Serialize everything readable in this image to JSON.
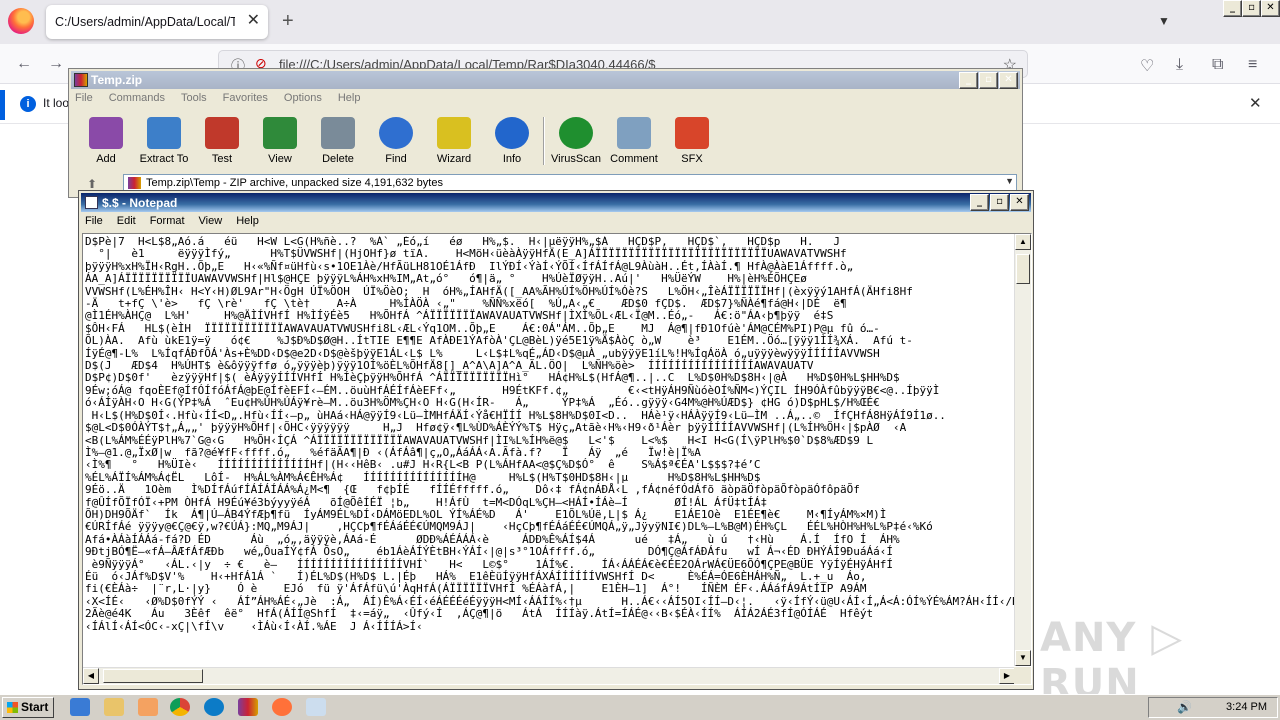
{
  "browser": {
    "tab_title": "C:/Users/admin/AppData/Local/Temp/Ra",
    "tab_close": "✕",
    "new_tab": "+",
    "list_tabs": "▼",
    "url": "file:///C:/Users/admin/AppData/Local/Temp/Rar$DIa3040.44466/$",
    "notification_text": "It loo",
    "notification_close": "✕",
    "caption": {
      "minimize": "_",
      "maximize": "▫",
      "close": "✕"
    },
    "back": "←",
    "forward": "→",
    "reload": "⟳",
    "home": "⌂"
  },
  "winrar": {
    "title": "Temp.zip",
    "menu": [
      "File",
      "Commands",
      "Tools",
      "Favorites",
      "Options",
      "Help"
    ],
    "toolbar": [
      {
        "label": "Add",
        "color": "#8a4aa8"
      },
      {
        "label": "Extract To",
        "color": "#3d7fc9"
      },
      {
        "label": "Test",
        "color": "#c0392b"
      },
      {
        "label": "View",
        "color": "#2f8a3a"
      },
      {
        "label": "Delete",
        "color": "#7a8b99"
      },
      {
        "label": "Find",
        "color": "#2f6fd0"
      },
      {
        "label": "Wizard",
        "color": "#d9c020"
      },
      {
        "label": "Info",
        "color": "#2266cc"
      },
      {
        "label": "VirusScan",
        "color": "#1f8f2f"
      },
      {
        "label": "Comment",
        "color": "#7fa0c0"
      },
      {
        "label": "SFX",
        "color": "#d8452a"
      }
    ],
    "path": "Temp.zip\\Temp - ZIP archive, unpacked size 4,191,632 bytes"
  },
  "notepad": {
    "title": "$.$ - Notepad",
    "menu": [
      "File",
      "Edit",
      "Format",
      "View",
      "Help"
    ],
    "content": "D$Pè|7  H<L$8„Aó.á   éü   H<W L<G(H%ñè..?  %Á` „Éó„í   éø   H%„$.  H‹|µëÿÿH%„$Á   HÇD$P,   HÇD$`,   HÇD$p   H.   J\n  °|   è1     ëÿÿÿÌfý„      H%T$ÜVWSHf|(HjOHf}ø tïA.    H<MöH‹üèàÀÿÿHfÄ(E_A]ÁÏÏÏÏÏÏÏÏÏÏÏÏÏÏÏÏÏÏÏÏÏÏÏÏÏÏUAWAVATVWSHf\nþÿÿÿH%xH%ÏH‹RgH..Õþ„E   H‹«%Ñf¤üHfù‹s•1OE1Àè/HfÃüLH81OÉ1ÁfÐ  IlÝÐÍ‹ÝàÍ‹ÝÕÍ‹ÍfÁÍfÁ@L9ÀùàH..Ét,ÍÀàÍ.¶ HfÀ@ÀàE1Áffff.ò„\nÁA_A]ÁÏÏÏÏÏÏÏÏÏÏUAWAVVWSHf|Hl$@HÇE þÿÿÿL%ÁH%xH%IM„At„ó°   ó¶|ä„ °    H%ÚèÏØÿÿH..Aú|'   H%ÜëÝW    H%|èH%ÉÕHÇEø\nVVWSHf(L%ÉH%ÎH‹ H<Y‹H)ØL9Ar\"H‹ÖgH ÚÏ%ÖOH  ÚÏ%ÖèO;  H  óH%„ÍAHfÄ([_AA%ÃH%ÚÍ%ÖH%ÚÍ%Óè?S   L%ÖH‹„ÎèÁÏÏÏÏÏÏHf|(èxÿÿý1AHfÁ(ÄHfi8Hf\n-Ä   t+fÇ \\'è>   fÇ \\rè'   fÇ \\tè†    A÷À     H%ÍÀÖÀ ‹„\"    %ÑÑ%xëó[  %Ú„A‹„€    ÆD$0 fÇD$.  ÆD$7}%ÑÀé¶fá@H‹|DÉ  ë¶\n@Ì1ÉH%ÀHÇ@  L%H'     H%@ÄÌÍVHfÍ H%ÌÍÿÉè5   H%ÕHfÁ ^ÁÏÏÏÏÏÏÏAWAVAUATVWSHf|ÌXÌ%ÕL‹ÆL‹Ï@M..Éó„-   Á€:ö\"ÁA‹þ¶þÿÿ  é‡S\n$ÔH‹FÁ   HL$(èÌH  ÏÏÏÏÏÏÏÏÏÏÏÏAWAVAUATVWUSHfi8L‹ÆL‹Ýq1OM..Õþ„E    Á€:0Á\"ÁM..Õþ„E    MJ  Á@¶|fÐ1Ofúè'ÁM@CÉM%PI)P@µ fû ó…-\nÕL)ÀA.  Afù ùkE1ÿ=ÿ   ó¢€    %J$Ð%D$Ø@H..ÍtTIE E¶¶E AfÀÐE1ÝAfòÀ'ÇL@BèL)ÿé5E1ÿ%Ä$ÀòÇ ò„W    è³    E1ÉM..Öó…[ÿÿÿ1ÌÍ¾XÁ.  Afú t-\nÍÿÉ@¶-L%  L%ÍqfÁÐfÕÁ'Às+È%DD‹D$@e2D‹D$@èšþÿÿE1ÁL‹L$ L%     L‹L$‡L%qÉ„ÁD‹D$@µÀ „ubÿÿÿE1íL%!H%ÍqÁöÀ ó„uÿÿÿèwÿÿÿÍÍÍÍÍAVVWSH\nD$(J   ÆD$4  H%ÚHT$ è&ôÿÿÿffø ó„ÿÿÿèþ)ÿÿÿ1OÍ%öÈL%ÕHfÄ8[]_A^A\\A]A^A_ÃL.ÖO|  L%ÑH%öè>  ÍÍÍÍÍÍÍÍÍÍÍÍÍÍÍÍAWAVAUATV\nD$P¢)D$0f'   èzÿÿÿHf|$( èÁÿÿÿÍÍÍVHfÍ H%ÍèÇþÿÿH%ÕHfÁ ^ÁÏÏÏÏÏÏÏÏÏÏHì°   HÁ¢H%L$(HfÁ@¶..|..C  L%D$0H%D$8H‹|@À   H%D$0H%L$HH%D$\n9Éw;óÁ@ fqoÈEf@ÍfÓÍfóÁfÁ@þE@ÍfèEFÍ‹—ÉM..öuùHfÁÉÍfÁèEFf‹„       H9ÉtKFf.¢„         €‹<tHÿÁH9ÑùóèOÍ%ÑM<)ÝÇIL ÍH9ÓÀfûbÿÿÿB€<@..ÍþÿÿÌ\nó‹ÁÍÿÀH‹O H‹G(ÝP‡%Á  ˆEu¢H%ÚH%ÚÁÿ¥rè—M..öu3H%ÖM%ÇH‹O H‹G(H‹ÍR-   Á„     ÝP‡%Á  „Éó..gÿÿÿ‹G4M%@H%ÚÆD$} ¢HG ó)D$pHL$/H%ŒÉ€\n H‹L$(H%D$0Í‹.Hfù‹ÍÍ<D„.Hfù‹ÍÍ‹—p„ ùHAá‹HÁ@ÿÿÍ9‹Lü—ÌMHfÁÄÍ‹Ýå€HÏÍÍ H%L$8H%D$0I<D..  HÁè¹ÿ‹HÁÀÿÿÍ9‹Lü—ÌM ..Á„..©  ÍfÇHfÁ8HÿÁÍ9Í1ø..\n$@L<D$0ÓÀÝT$†„Á„„' þÿÿÿH%ÕHf|‹ÕHC‹ÿÿÿÿÿÿ     H„J  Hfø¢ÿ‹¶L%ÙD%ÁÈÝÝ%T$ Hÿç„Atãè‹H%‹H9‹ð¹Áèr þÿÿÍÍÍÍAVVWSHf|(L%ÍH%ÖH‹|$pÀØ  ‹A\n<B(L%ÁM%ÉÉÿPlH%7`G@‹G   H%ÕH‹ÍÇÁ ^ÁÏÏÏÏÏÏÏÏÏÏÏÏÏAWAVAUATVWSHf|ÌI%L%ÍH%ë@$   L<'$    L<%$   H<I H<G(Í\\ÿPlH%$0`D$8%ÆD$9 L\nÌ%—@1.@„ÏxØ|w  fã?@é¥fF‹ffff.ó„   %éfäÃA¶|Ð ‹(ÁfÁâ¶|ç„O„ÁáÁÁ‹A.Ãfà.f?   Ï   Áÿ  „é   Ïw!è|Ï%A\n‹Ì%¶   °   H%ÜIè‹   ÍÍÍÍÍÍÍÍÍÍÍÍÍÍHf|(H‹‹HêB‹ .u#J H‹R{L<B P(L%ÁHfAA<@$Ç%D$Ó°  ê    S%Á$ª€ÉA'L$$$?‡é’C\n%ÉL%ÁÏÍ%ÁM%Á¢ËL   LôÍ-  H%ÁL%ÀM%Á€ÊH%Á¢   ÍÍÍÍÍÍÍÍÍÍÍÍÍÍÍH@     H%L$(H%T$0HD$8H‹|µ      H%D$8H%L$HH%D$\n9Éö..Ä   1Oèm   Ì%DÍfÁúfÍÁÍÁÍÁÁ%Á¿M<¶  {Œ   f¢þÍÉ   fÍÍÉfffff.ó„    Dô‹‡ fÁ¢nÁÐÅ‹L ‚fÁ¢néfÓdÁfõ äòpäÖfòpäÕfòpäÓfôpäÕf\nf@ÛÍfÕÏfÓÏ‹+PM ÒHfÁ H9Éú¥é3býyyÿéÁ   õÍ@ÕêÍÉÏ ¦b„    H!ÁfÙ  t=M<DÓqL%ÇH—<HÁÍ•ÍÁè—Í       ØÍ!ÁL ÁfÜ‡tÍÁ‡\nÕH)DH9ÕÄf`  Ík  Á¶|Ú—ÁB4ÝfÆþ¶fü  ÍyÁM9ÉL%DÍ‹DÁMöEDL%OL ÝÍ%ÁÉ%D   Á'    E1ÕL%Úë,L|$ Á¿    E1ÁE1Oè  E1ÉE¶è€    M‹¶ÍyÁM%×M)Ì\n€ÚRÍfÁé ÿÿÿy@€Ç@€ÿ,w?€ÚÁ}:MQ„M9ÁJ|    ,HÇCþ¶fÉÁáÉÉ€ÚMQM9ÁJ|    ‹HçCþ¶fÉÁáÉÉ€ÚMQÁ„ÿ„JÿyÿNI€)DL%—L%B@M)ÉH%ÇL   ÉÉL%HÒH%H%L%P‡é‹%Kó\nAfá•ÀÁàÍÁÁá-fá?D ÉD      Áù  „ó„,äÿÿÿè‚ÁAá-É      ØDÐ%ÁÉÁÁÁ‹è     ÁDÐ%Ê%ÁÍ$4Á      ué   ‡Á„   ù ú   †‹Hù    Á.Í  ÍfO Í  ÁH%\n9ÐtjBÓ¶Ë—«fÁ—ÂÆfÁfÆÐb   wé„ÔuaÍÝ¢fÁ ÕsO„    éb1ÁèÁÍÝÈtBH‹ÝÁÍ‹|@|s³°1OÁffff.ó„        DÓ¶Ç@ÁfÁÐÁfu   wÍ Á¬‹ÉD ÐHÝÁÍ9ÐuáÁá‹Í\n è9ÑÿÿÿÁ°   ‹ÁL.‹|y  ÷ €   è—   ÍÍÍÍÍÍÍÍÍÍÍÍÍÍÍÍVHÍ`   H<   L©$°    1ÁÍ%€.    ÍÁ‹ÁÁÉÁ€è€ÉE2OÁrWÁ€ÜE6ÕÓ¶ÇPE@BÜE YÿÍÿÉHÿÁHfÍ\nÉü  ó‹JÁf%D$V'%    H‹+HfÁ1Á `   Í)ÉL%D$(H%D$ L.|Éþ   HÁ%  E1êÈüÍÿÿHfÁXÁÍÍÍÍÍÍVWSHfÍ D<     È%ÉÁ=ÓE6ÈHÁH%Ñ„  L.+_u  Áo‚\nfi(€ÈÁà÷  |¨r‚L·|y}    Ó è    EJó  fü ÿ'ÁfÁfü\\ú'ÀqHfÁ(ÁÏÏÏÏÏÏVHfÍ %ÉÁàfÁ‚|    E1ÈH—1]  Á°!   ÍÑÈM ÉF‹.ÁÁáfÁ9ÁtÍIP A9ÁM\n‹X<ÍÉ‹   ‹Ø%D$0fÝÝ ‹   ÁÍ”ÁH%ÁÉ‹„Jè  :Á„  ÁÍ)Ê%Á‹ÉÍ‹éÁÉÉÉéÉÿÿÿH<MÍ‹ÁÁÍÍ%‹†µ      H..Á€‹‹ÁÍ5OI‹ÍÍ—D‹¦.   ‹ÿ‹ÍfÝ‹ü@U‹ÁÍ‹Í„Á<Á:ÓÍ%ÝÉ%ÁM?ÁH‹ÍÍ‹/Hë—  H..ÁÁ\n2Ãè@é4K   Áu   3Èêf  êë°  HfÁ(ÁÍÍ@ShfÍ  ‡‹=áÿ„  ‹Ûfý‹Í  ‚ÁÇ@¶|ö   ÁtÁ  ÍÍÍàÿ.ÁtÍ=ÍÁÉ@‹‹B‹$ÉÀ‹ÍÍ%  ÁÍÁ2ÁÉ3fÍ@ÓÍÁÉ  Hfêýt\n‹ÍÁlÍ‹ÁÍ<ÓC‹-xÇ|\\fÍ\\v    ‹ÌÁù‹Í‹ÀÍ.%ÁE  J Á‹ÍÍÍÁ>Í‹\n\n\n\n"
  }
}
